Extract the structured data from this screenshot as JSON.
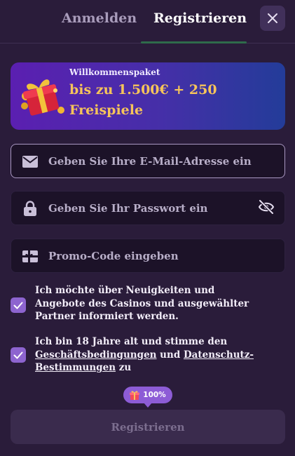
{
  "tabs": {
    "login_label": "Anmelden",
    "register_label": "Registrieren",
    "active": "register"
  },
  "close": {
    "icon": "close-icon"
  },
  "promo": {
    "small_label": "Willkommenspaket",
    "headline": "bis zu 1.500€ + 250 Freispiele",
    "icon": "gift-icon"
  },
  "email": {
    "placeholder": "Geben Sie Ihre E-Mail-Adresse ein",
    "value": "",
    "icon": "envelope-icon"
  },
  "password": {
    "placeholder": "Geben Sie Ihr Passwort ein",
    "value": "",
    "icon": "lock-icon",
    "toggle_icon": "eye-slash-icon"
  },
  "promo_code": {
    "placeholder": "Promo-Code eingeben",
    "value": "",
    "icon": "gift-card-icon"
  },
  "consent_marketing": {
    "checked": true,
    "text": "Ich möchte über Neuigkeiten und Angebote des Casinos und ausgewählter Partner informiert werden."
  },
  "consent_terms": {
    "checked": true,
    "text_before": "Ich bin 18 Jahre alt und stimme den ",
    "terms_link": "Geschäftsbedingungen",
    "text_middle": " und ",
    "privacy_link": "Datenschutz-Bestimmungen",
    "text_after": " zu"
  },
  "progress": {
    "label": "100%",
    "value": 1.0,
    "icon": "gift-icon"
  },
  "submit": {
    "label": "Registrieren",
    "enabled": false
  },
  "colors": {
    "background": "#2a1c3a",
    "field_bg": "#1c1228",
    "accent_purple": "#8d64cf",
    "promo_gold": "#f6c45a",
    "promo_gradient_start": "#5b1fb1",
    "promo_gradient_end": "#233c99",
    "tab_indicator": "#2f6b4b"
  }
}
